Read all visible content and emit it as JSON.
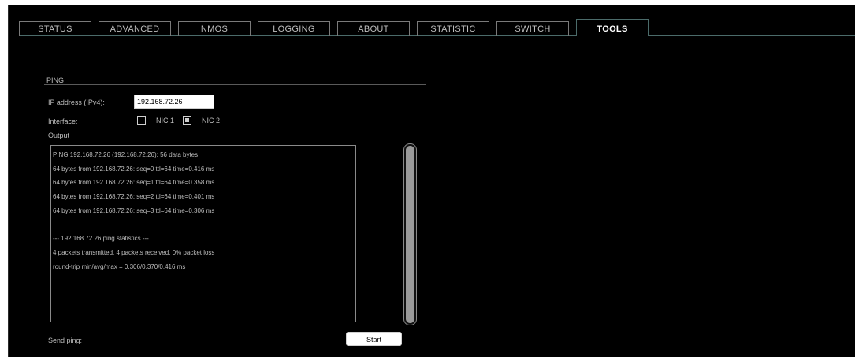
{
  "tabs": [
    {
      "label": "STATUS"
    },
    {
      "label": "ADVANCED"
    },
    {
      "label": "NMOS"
    },
    {
      "label": "LOGGING"
    },
    {
      "label": "ABOUT"
    },
    {
      "label": "STATISTIC"
    },
    {
      "label": "SWITCH"
    },
    {
      "label": "TOOLS",
      "active": true
    }
  ],
  "ping": {
    "section_title": "PING",
    "ip_label": "IP address (IPv4):",
    "ip_value": "192.168.72.26",
    "interface_label": "Interface:",
    "nic1_label": "NIC 1",
    "nic1_checked": false,
    "nic2_label": "NIC 2",
    "nic2_checked": true,
    "output_label": "Output",
    "output_lines": [
      "PING 192.168.72.26 (192.168.72.26): 56 data bytes",
      "64 bytes from 192.168.72.26: seq=0 ttl=64 time=0.416 ms",
      "64 bytes from 192.168.72.26: seq=1 ttl=64 time=0.358 ms",
      "64 bytes from 192.168.72.26: seq=2 ttl=64 time=0.401 ms",
      "64 bytes from 192.168.72.26: seq=3 ttl=64 time=0.306 ms",
      "",
      "--- 192.168.72.26 ping statistics ---",
      "4 packets transmitted, 4 packets received, 0% packet loss",
      "round-trip min/avg/max = 0.306/0.370/0.416 ms"
    ],
    "send_label": "Send ping:",
    "start_label": "Start"
  }
}
